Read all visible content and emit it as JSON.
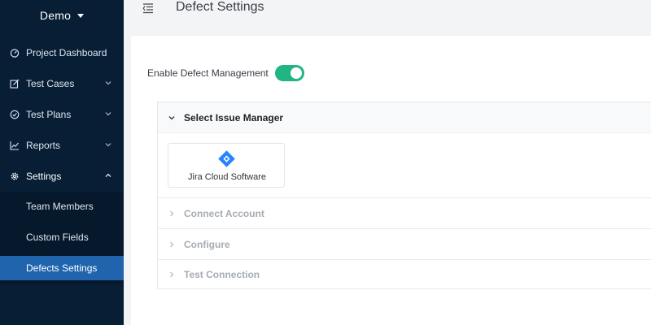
{
  "sidebar": {
    "workspace": "Demo",
    "items": [
      {
        "label": "Project Dashboard"
      },
      {
        "label": "Test Cases"
      },
      {
        "label": "Test Plans"
      },
      {
        "label": "Reports"
      },
      {
        "label": "Settings"
      }
    ],
    "sub_items": [
      {
        "label": "Team Members"
      },
      {
        "label": "Custom Fields"
      },
      {
        "label": "Defects Settings"
      }
    ]
  },
  "header": {
    "title": "Defect Settings"
  },
  "main": {
    "toggle_label": "Enable Defect Management",
    "toggle_on": true,
    "sections": [
      {
        "label": "Select Issue Manager",
        "state": "open"
      },
      {
        "label": "Connect Account",
        "state": "disabled"
      },
      {
        "label": "Configure",
        "state": "disabled"
      },
      {
        "label": "Test Connection",
        "state": "disabled"
      }
    ],
    "issue_manager_tile": {
      "label": "Jira Cloud Software",
      "icon": "jira-icon"
    }
  },
  "colors": {
    "sidebar_bg": "#071e35",
    "active_item": "#1f64ad",
    "toggle_on": "#21b583",
    "jira_blue": "#2684ff"
  }
}
